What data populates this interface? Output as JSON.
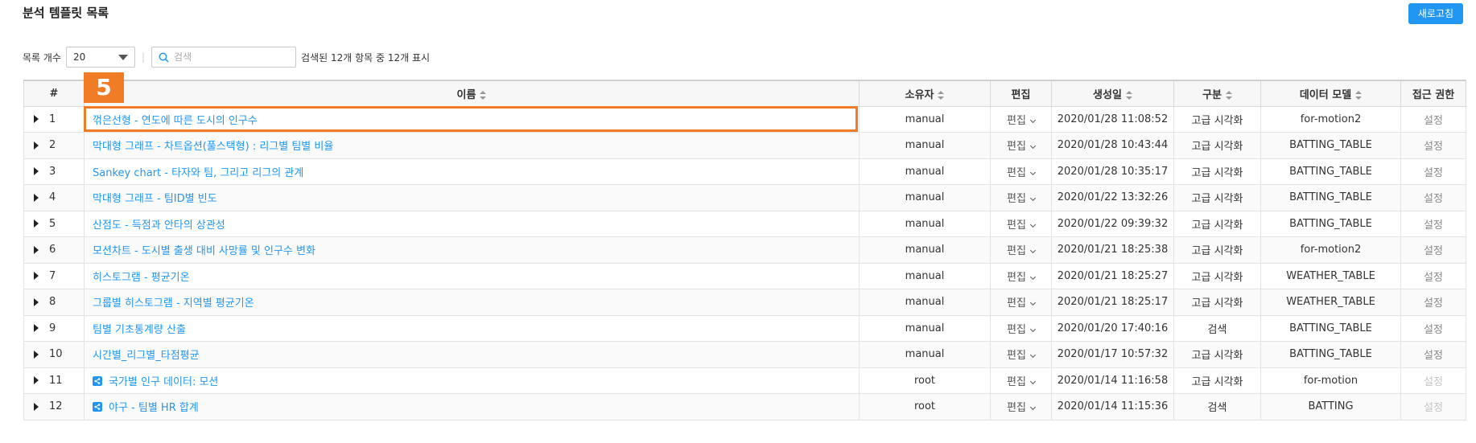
{
  "page": {
    "title": "분석 템플릿 목록",
    "refresh_label": "새로고침"
  },
  "toolbar": {
    "count_label": "목록 개수",
    "count_value": "20",
    "search_placeholder": "검색",
    "result_text": "검색된 12개 항목 중 12개 표시"
  },
  "table": {
    "headers": [
      "#",
      "이름",
      "소유자",
      "편집",
      "생성일",
      "구분",
      "데이터 모델",
      "접근 권한"
    ],
    "rows": [
      {
        "num": "1",
        "name": "꺾은선형 - 연도에 따른 도시의 인구수",
        "owner": "manual",
        "edit": "편집",
        "created": "2020/01/28 11:08:52",
        "category": "고급 시각화",
        "model": "for-motion2",
        "access": "설정",
        "shared": false
      },
      {
        "num": "2",
        "name": "막대형 그래프 - 차트옵션(풀스택형) : 리그별 팀별 비율",
        "owner": "manual",
        "edit": "편집",
        "created": "2020/01/28 10:43:44",
        "category": "고급 시각화",
        "model": "BATTING_TABLE",
        "access": "설정",
        "shared": false
      },
      {
        "num": "3",
        "name": "Sankey chart - 타자와 팀, 그리고 리그의 관계",
        "owner": "manual",
        "edit": "편집",
        "created": "2020/01/28 10:35:17",
        "category": "고급 시각화",
        "model": "BATTING_TABLE",
        "access": "설정",
        "shared": false
      },
      {
        "num": "4",
        "name": "막대형 그래프 - 팀ID별 빈도",
        "owner": "manual",
        "edit": "편집",
        "created": "2020/01/22 13:32:26",
        "category": "고급 시각화",
        "model": "BATTING_TABLE",
        "access": "설정",
        "shared": false
      },
      {
        "num": "5",
        "name": "산점도 - 득점과 안타의 상관성",
        "owner": "manual",
        "edit": "편집",
        "created": "2020/01/22 09:39:32",
        "category": "고급 시각화",
        "model": "BATTING_TABLE",
        "access": "설정",
        "shared": false
      },
      {
        "num": "6",
        "name": "모션차트 - 도시별 출생 대비 사망률 및 인구수 변화",
        "owner": "manual",
        "edit": "편집",
        "created": "2020/01/21 18:25:38",
        "category": "고급 시각화",
        "model": "for-motion2",
        "access": "설정",
        "shared": false
      },
      {
        "num": "7",
        "name": "히스토그램 - 평균기온",
        "owner": "manual",
        "edit": "편집",
        "created": "2020/01/21 18:25:27",
        "category": "고급 시각화",
        "model": "WEATHER_TABLE",
        "access": "설정",
        "shared": false
      },
      {
        "num": "8",
        "name": "그룹별 히스토그램 - 지역별 평균기온",
        "owner": "manual",
        "edit": "편집",
        "created": "2020/01/21 18:25:17",
        "category": "고급 시각화",
        "model": "WEATHER_TABLE",
        "access": "설정",
        "shared": false
      },
      {
        "num": "9",
        "name": "팀별 기초통계량 산출",
        "owner": "manual",
        "edit": "편집",
        "created": "2020/01/20 17:40:16",
        "category": "검색",
        "model": "BATTING_TABLE",
        "access": "설정",
        "shared": false
      },
      {
        "num": "10",
        "name": "시간별_리그별_타점평균",
        "owner": "manual",
        "edit": "편집",
        "created": "2020/01/17 10:57:32",
        "category": "고급 시각화",
        "model": "BATTING_TABLE",
        "access": "설정",
        "shared": false
      },
      {
        "num": "11",
        "name": "국가별 인구 데이터: 모션",
        "owner": "root",
        "edit": "편집",
        "created": "2020/01/14 11:16:58",
        "category": "고급 시각화",
        "model": "for-motion",
        "access": "설정",
        "shared": true
      },
      {
        "num": "12",
        "name": "야구 - 팀별 HR 합계",
        "owner": "root",
        "edit": "편집",
        "created": "2020/01/14 11:15:36",
        "category": "검색",
        "model": "BATTING",
        "access": "설정",
        "shared": true
      }
    ]
  },
  "annotation": {
    "step_number": "5",
    "highlight_color": "#f07c25"
  },
  "colors": {
    "accent": "#2196f3",
    "link": "#2196f3"
  },
  "icons": {
    "sort": "sort-icon",
    "expand": "expand-triangle-icon",
    "search": "search-icon",
    "shared": "share-icon",
    "dropdown": "chevron-down-icon"
  }
}
